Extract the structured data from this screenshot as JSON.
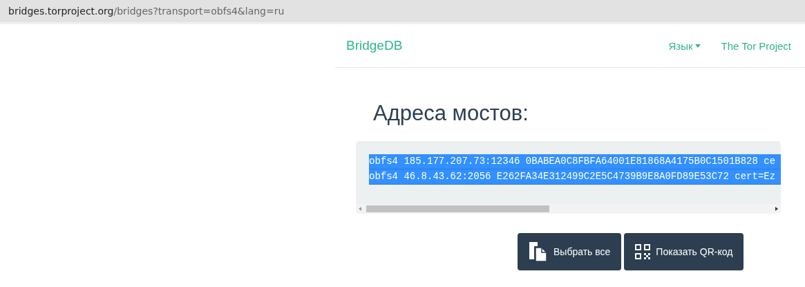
{
  "address_bar": {
    "host": "bridges.torproject.org",
    "path": "/bridges?transport=obfs4&lang=ru"
  },
  "navbar": {
    "brand": "BridgeDB",
    "links": [
      {
        "label": "Язык",
        "kind": "dropdown"
      },
      {
        "label": "The Tor Project",
        "kind": "link"
      }
    ]
  },
  "heading": "Адреса мостов:",
  "bridge_lines": [
    {
      "text": "obfs4 185.177.207.73:12346 0BABEA0C8FBFA64001E81868A4175B0C1501B828 ce",
      "selected": true
    },
    {
      "text": "obfs4 46.8.43.62:2056 E262FA34E312499C2E5C4739B9E8A0FD89E53C72 cert=Ez",
      "selected": true
    }
  ],
  "buttons": [
    {
      "label": "Выбрать все",
      "kind": "select"
    },
    {
      "label": "Показать QR-код",
      "kind": "qr"
    }
  ]
}
